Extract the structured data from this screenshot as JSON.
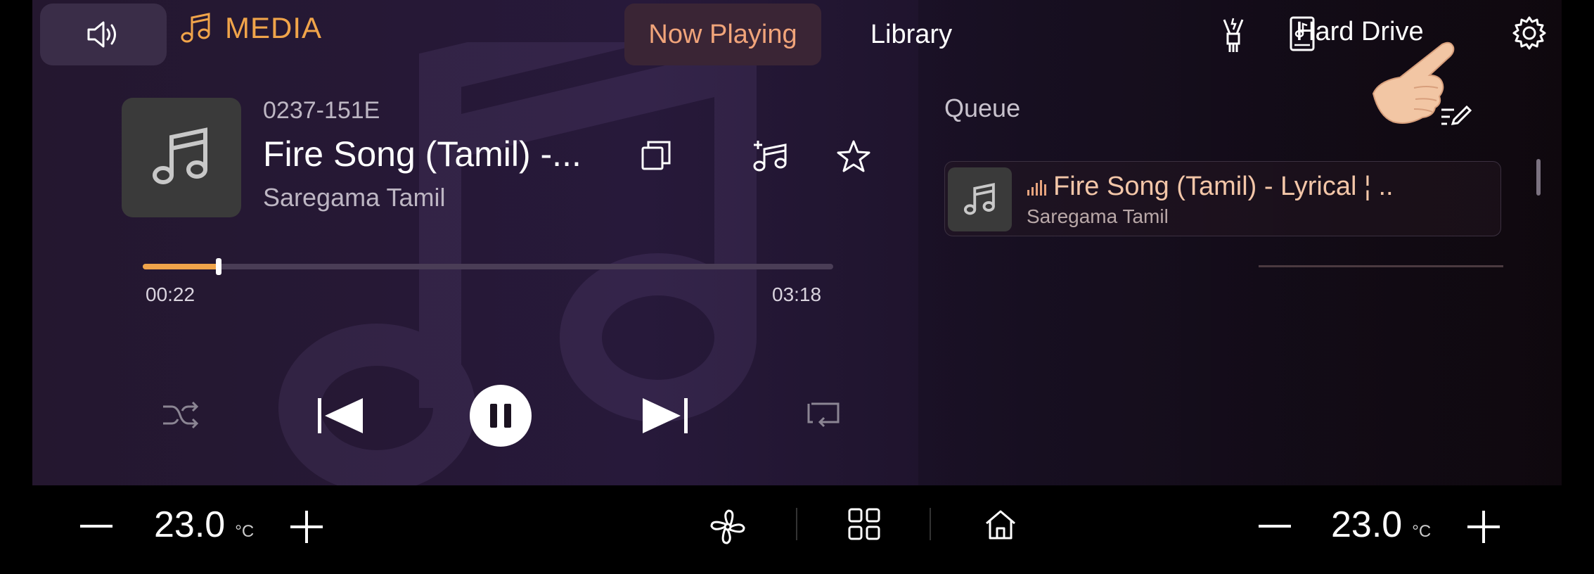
{
  "header": {
    "app_title": "MEDIA",
    "tabs": [
      {
        "label": "Now Playing",
        "active": true
      },
      {
        "label": "Library",
        "active": false
      }
    ],
    "source_label": "Hard Drive"
  },
  "now_playing": {
    "track_code": "0237-151E",
    "title": "Fire Song (Tamil) -...",
    "artist": "Saregama Tamil",
    "elapsed": "00:22",
    "duration": "03:18",
    "progress_fraction": 0.11
  },
  "queue": {
    "title": "Queue",
    "items": [
      {
        "title": "Fire Song (Tamil) - Lyrical ¦ ..",
        "artist": "Saregama Tamil"
      }
    ]
  },
  "climate": {
    "left_temp": "23.0",
    "right_temp": "23.0",
    "unit": "°C"
  },
  "colors": {
    "accent": "#f0a44a",
    "background": "#24172f"
  }
}
